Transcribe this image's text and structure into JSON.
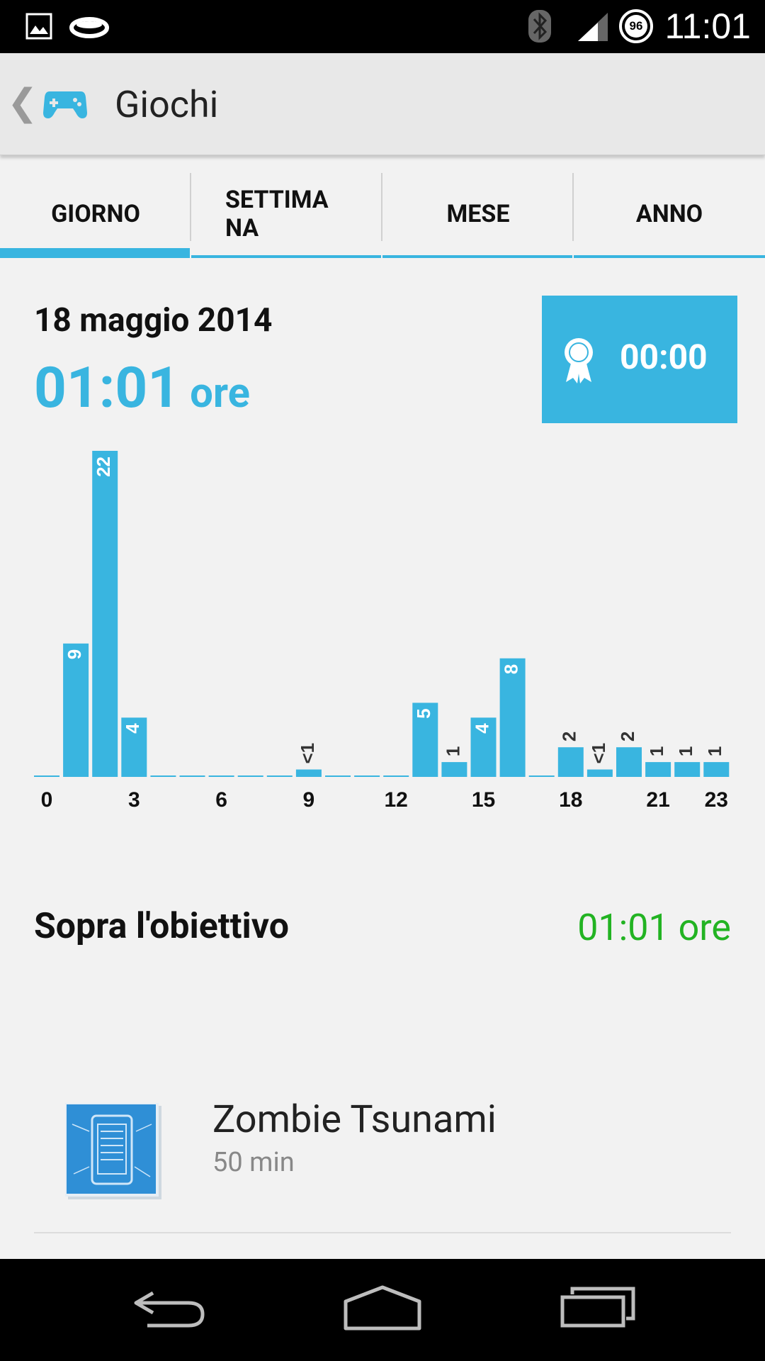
{
  "status_bar": {
    "time": "11:01",
    "battery_level": "96",
    "icons": [
      "image-notification-icon",
      "ring-notification-icon",
      "bluetooth-icon",
      "signal-icon",
      "battery-icon"
    ]
  },
  "action_bar": {
    "title": "Giochi",
    "icon": "gamepad-icon"
  },
  "tabs": [
    {
      "label": "GIORNO",
      "active": true
    },
    {
      "label": "SETTIMA\nNA",
      "active": false
    },
    {
      "label": "MESE",
      "active": false
    },
    {
      "label": "ANNO",
      "active": false
    }
  ],
  "summary": {
    "date": "18 maggio 2014",
    "total_value": "01:01",
    "total_unit": "ore",
    "goal_time": "00:00",
    "goal_icon": "award-ribbon-icon"
  },
  "chart_data": {
    "type": "bar",
    "categories": [
      "0",
      "1",
      "2",
      "3",
      "4",
      "5",
      "6",
      "7",
      "8",
      "9",
      "10",
      "11",
      "12",
      "13",
      "14",
      "15",
      "16",
      "17",
      "18",
      "19",
      "20",
      "21",
      "22",
      "23"
    ],
    "values": [
      0,
      9,
      22,
      4,
      0,
      0,
      0,
      0,
      0,
      0.5,
      0,
      0,
      0,
      5,
      1,
      4,
      8,
      0,
      2,
      0.5,
      2,
      1,
      1,
      1
    ],
    "labels": [
      "",
      "9",
      "22",
      "4",
      "",
      "",
      "",
      "",
      "",
      "<1",
      "",
      "",
      "",
      "5",
      "1",
      "4",
      "8",
      "",
      "2",
      "<1",
      "2",
      "1",
      "1",
      "1"
    ],
    "x_tick_labels": [
      "0",
      "3",
      "6",
      "9",
      "12",
      "15",
      "18",
      "21",
      "23"
    ],
    "x_tick_positions": [
      0,
      3,
      6,
      9,
      12,
      15,
      18,
      21,
      23
    ],
    "ylim": [
      0,
      22
    ],
    "color": "#39b5e0"
  },
  "goal_section": {
    "label": "Sopra l'obiettivo",
    "value": "01:01 ore",
    "value_color": "#22b322"
  },
  "apps": [
    {
      "name": "Zombie Tsunami",
      "duration": "50 min",
      "icon": "blueprint-app-icon"
    }
  ],
  "nav_bar": {
    "icons": [
      "back-icon",
      "home-icon",
      "recent-apps-icon"
    ]
  }
}
